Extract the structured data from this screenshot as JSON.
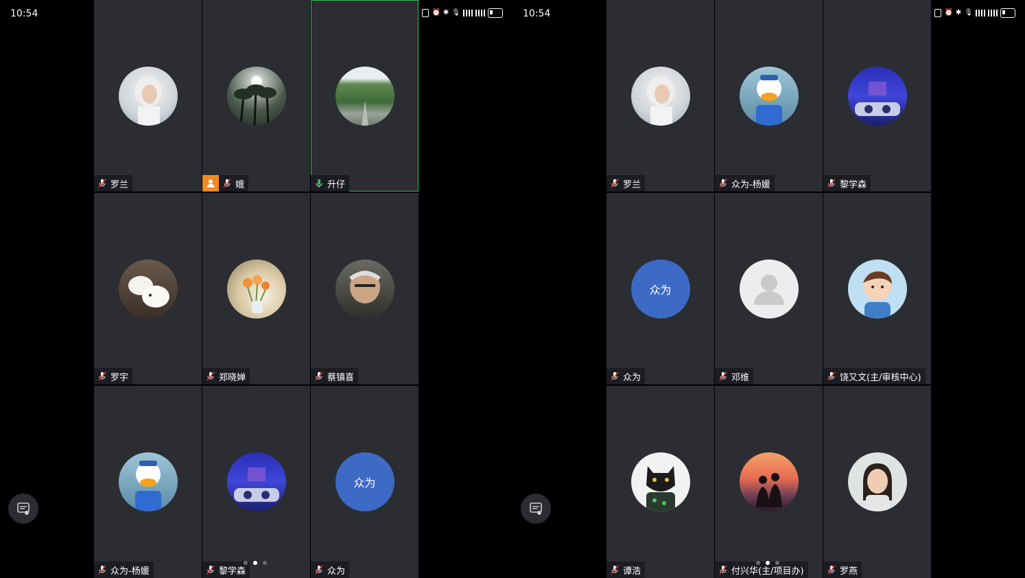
{
  "colors": {
    "tile_bg": "#2b2d33",
    "active_border": "#2dbf5a",
    "avatar_blue": "#3d6ac5",
    "host_badge": "#f08a24"
  },
  "left": {
    "time": "10:54",
    "tiles": [
      {
        "name": "罗兰",
        "mic": "muted",
        "avatar": "photo-white-hair-woman"
      },
      {
        "name": "娥",
        "mic": "muted",
        "avatar": "photo-palm-trees",
        "badge": "host-icon"
      },
      {
        "name": "升仔",
        "mic": "active",
        "avatar": "photo-green-road",
        "active": true
      },
      {
        "name": "罗宇",
        "mic": "muted",
        "avatar": "photo-white-lambs"
      },
      {
        "name": "郑晓婵",
        "mic": "muted",
        "avatar": "photo-tulips"
      },
      {
        "name": "蔡镇喜",
        "mic": "muted",
        "avatar": "photo-anime-old-man"
      },
      {
        "name": "众为-杨媛",
        "mic": "muted",
        "avatar": "photo-donald-duck"
      },
      {
        "name": "黎学森",
        "mic": "muted",
        "avatar": "photo-blue-stage"
      },
      {
        "name": "众为",
        "mic": "muted",
        "avatar_text": "众为"
      }
    ],
    "page_dots": [
      false,
      true,
      false
    ]
  },
  "right": {
    "time": "10:54",
    "tiles": [
      {
        "name": "罗兰",
        "mic": "muted",
        "avatar": "photo-white-hair-woman"
      },
      {
        "name": "众为-杨媛",
        "mic": "muted",
        "avatar": "photo-donald-duck"
      },
      {
        "name": "黎学森",
        "mic": "muted",
        "avatar": "photo-blue-stage"
      },
      {
        "name": "众为",
        "mic": "muted",
        "avatar_text": "众为"
      },
      {
        "name": "邓维",
        "mic": "muted",
        "avatar": "default-person"
      },
      {
        "name": "饶又文(主/审核中心)",
        "mic": "muted",
        "avatar": "cartoon-boy"
      },
      {
        "name": "谭浩",
        "mic": "muted",
        "avatar": "black-panther-art"
      },
      {
        "name": "付兴华(主/项目办)",
        "mic": "muted",
        "avatar": "photo-sunset-couple"
      },
      {
        "name": "罗燕",
        "mic": "muted",
        "avatar": "photo-woman"
      }
    ],
    "page_dots": [
      false,
      true,
      false
    ]
  }
}
